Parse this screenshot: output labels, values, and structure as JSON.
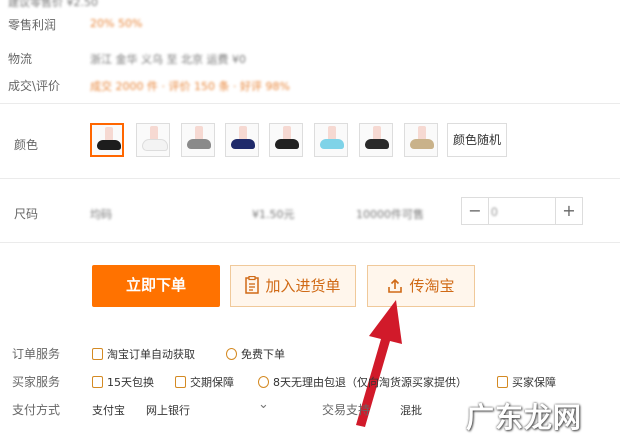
{
  "info_rows": [
    {
      "label": "零售利润",
      "value": "20% 50%"
    },
    {
      "label": "物流",
      "value": "浙江 金华 义乌 至 北京 运费 ¥0"
    },
    {
      "label": "成交\\评价",
      "value": "成交 2000 件 · 评价 150 条 · 好评 98%"
    }
  ],
  "top_cut_text": "建议零售价 ¥2.50",
  "color": {
    "label": "颜色",
    "swatches": [
      {
        "name": "black",
        "sock_color": "#1d1d1d"
      },
      {
        "name": "white",
        "sock_color": "#f3f3f3"
      },
      {
        "name": "gray",
        "sock_color": "#8a8a8a"
      },
      {
        "name": "navy",
        "sock_color": "#1f2a6a"
      },
      {
        "name": "black-2",
        "sock_color": "#222222"
      },
      {
        "name": "light-blue",
        "sock_color": "#7fd3e8"
      },
      {
        "name": "black-3",
        "sock_color": "#2a2a2a"
      },
      {
        "name": "khaki",
        "sock_color": "#c9b28a"
      }
    ],
    "random_label": "颜色随机"
  },
  "size": {
    "label": "尺码",
    "blur_values": [
      "均码",
      "¥1.50元",
      "10000件可售"
    ],
    "stepper": {
      "minus": "−",
      "plus": "+",
      "value": "0"
    }
  },
  "actions": {
    "order": "立即下单",
    "cart": "加入进货单",
    "taobao": "传淘宝"
  },
  "services": {
    "order_label": "订单服务",
    "order_items": [
      "淘宝订单自动获取",
      "免费下单"
    ],
    "buyer_label": "买家服务",
    "buyer_items": [
      "15天包换",
      "交期保障",
      "8天无理由包退（仅向淘货源买家提供）",
      "买家保障"
    ],
    "pay_label": "支付方式",
    "pay_items": [
      "支付宝",
      "网上银行"
    ],
    "trade_label": "交易支持",
    "trade_value": "混批"
  },
  "watermark": "广东龙网",
  "colors": {
    "accent": "#ff7200",
    "arrow": "#d11a2a"
  }
}
